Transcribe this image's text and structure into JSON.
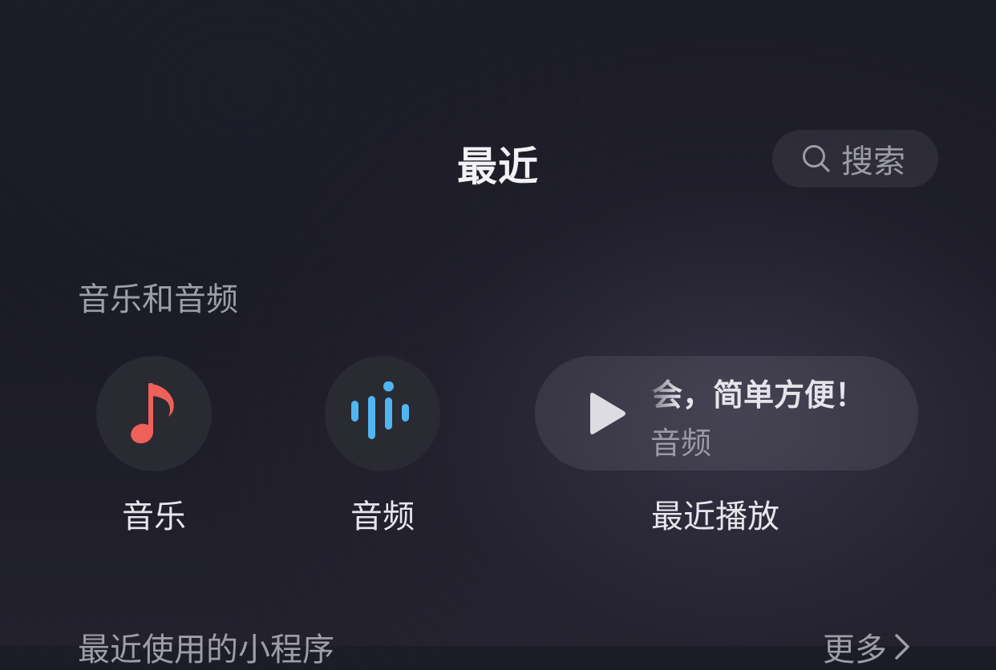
{
  "header": {
    "title": "最近",
    "search_label": "搜索",
    "search_icon": "search-icon"
  },
  "section_media": {
    "title": "音乐和音频",
    "tiles": [
      {
        "label": "音乐",
        "icon": "music-note-icon",
        "color": "#f0605a"
      },
      {
        "label": "音频",
        "icon": "audio-wave-icon",
        "color": "#4fb6f2"
      }
    ],
    "recent_play": {
      "track_title": "会，简单方便！",
      "source": "音频",
      "label": "最近播放",
      "icon": "play-icon"
    }
  },
  "section_miniprograms": {
    "title": "最近使用的小程序",
    "more_label": "更多",
    "more_icon": "chevron-right-icon"
  }
}
